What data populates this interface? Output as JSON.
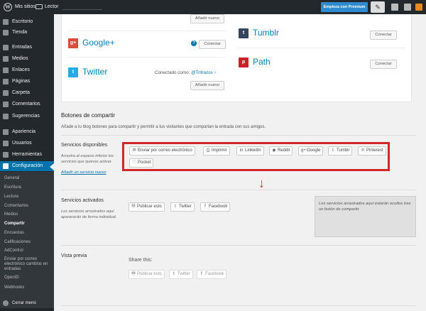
{
  "adminbar": {
    "my_sites": "Mis sitios",
    "reader": "Lector",
    "premium": "Empieza con Premium",
    "write_icon": "pencil-icon"
  },
  "sidebar": {
    "items": [
      {
        "label": "Escritorio",
        "icon": "dashboard-icon"
      },
      {
        "label": "Tienda",
        "icon": "store-icon"
      },
      {
        "label": "Entradas",
        "icon": "pin-icon"
      },
      {
        "label": "Medios",
        "icon": "media-icon"
      },
      {
        "label": "Enlaces",
        "icon": "links-icon"
      },
      {
        "label": "Páginas",
        "icon": "pages-icon"
      },
      {
        "label": "Carpeta",
        "icon": "folder-icon"
      },
      {
        "label": "Comentarios",
        "icon": "comments-icon"
      },
      {
        "label": "Sugerencias",
        "icon": "feedback-icon"
      },
      {
        "label": "Apariencia",
        "icon": "appearance-icon"
      },
      {
        "label": "Usuarios",
        "icon": "users-icon"
      },
      {
        "label": "Herramientas",
        "icon": "tools-icon"
      },
      {
        "label": "Configuración",
        "icon": "settings-icon"
      }
    ],
    "sub_items": [
      "General",
      "Escritura",
      "Lectura",
      "Comentarios",
      "Medios",
      "Compartir",
      "Encuestas",
      "Calificaciones",
      "AdControl",
      "Enviar por correo electrónico cambios en entradas",
      "OpenID",
      "Webhooks"
    ],
    "collapse": "Cerrar menú"
  },
  "connections": {
    "add_new": "Añadir nuevo",
    "connect": "Conectar",
    "google": {
      "name": "Google+",
      "button": "Conectar"
    },
    "twitter": {
      "name": "Twitter",
      "connected_as": "Conectado como:",
      "handle": "@Tritrazos",
      "remove": "×",
      "button": "Añadir nuevo"
    },
    "tumblr": {
      "name": "Tumblr",
      "button": "Conectar"
    },
    "path": {
      "name": "Path",
      "button": "Conectar"
    }
  },
  "sharing": {
    "title": "Botones de compartir",
    "description": "Añade a tu blog botones para compartir y permitir a tus visitantes que compartan la entrada con sus amigos.",
    "available": {
      "title": "Servicios disponibles",
      "desc": "Arrastra al espacio inferior los servicios que quieras activar.",
      "add_link": "Añadir un servicio nuevo",
      "buttons": [
        {
          "label": "Enviar por correo electrónico",
          "icon": "email-icon"
        },
        {
          "label": "Imprimir",
          "icon": "print-icon"
        },
        {
          "label": "LinkedIn",
          "icon": "linkedin-icon"
        },
        {
          "label": "Reddit",
          "icon": "reddit-icon"
        },
        {
          "label": "Google",
          "icon": "google-icon"
        },
        {
          "label": "Tumblr",
          "icon": "tumblr-icon"
        },
        {
          "label": "Pinterest",
          "icon": "pinterest-icon"
        },
        {
          "label": "Pocket",
          "icon": "pocket-icon"
        }
      ]
    },
    "enabled": {
      "title": "Servicios activados",
      "desc": "Los servicios arrastrados aquí aparecerán de forma individual.",
      "buttons": [
        {
          "label": "Publicar esto",
          "icon": "wordpress-icon"
        },
        {
          "label": "Twitter",
          "icon": "twitter-icon"
        },
        {
          "label": "Facebook",
          "icon": "facebook-icon"
        }
      ],
      "hidden_zone": "Los servicios arrastrados aquí estarán ocultos tras un botón de compartir."
    },
    "preview": {
      "title": "Vista previa",
      "share_this": "Share this:",
      "buttons": [
        {
          "label": "Publicar esto",
          "icon": "wordpress-icon"
        },
        {
          "label": "Twitter",
          "icon": "twitter-icon"
        },
        {
          "label": "Facebook",
          "icon": "facebook-icon"
        }
      ]
    }
  },
  "colors": {
    "accent": "#0073aa",
    "highlight": "#d1262a",
    "adminbar": "#23282d"
  }
}
